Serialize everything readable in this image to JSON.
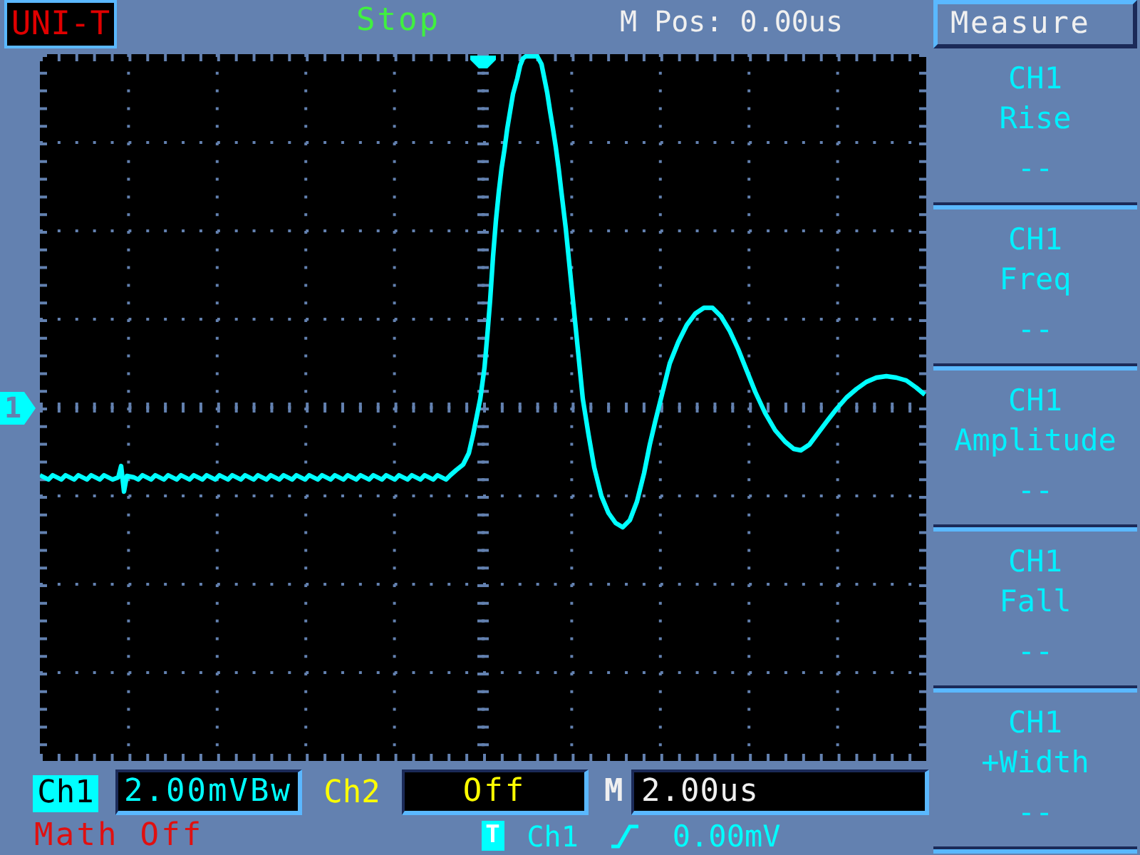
{
  "header": {
    "logo": "UNI-T",
    "run_status": "Stop",
    "position": "M Pos: 0.00us"
  },
  "display": {
    "channel_marker": "1"
  },
  "status": {
    "channels": [
      {
        "label": "Ch1",
        "scale": "2.00mVBw",
        "color": "#00ffff",
        "selected": true
      },
      {
        "label": "Ch2",
        "scale": "Off",
        "color": "#ffff00",
        "selected": false
      }
    ],
    "timebase": {
      "label": "M",
      "value": "2.00us"
    },
    "math": "Math Off",
    "trigger": {
      "badge": "T",
      "source": "Ch1",
      "rising": true,
      "level": "0.00mV"
    }
  },
  "menu": {
    "title": "Measure",
    "items": [
      {
        "channel": "CH1",
        "measure": "Rise",
        "value": "--"
      },
      {
        "channel": "CH1",
        "measure": "Freq",
        "value": "--"
      },
      {
        "channel": "CH1",
        "measure": "Amplitude",
        "value": "--"
      },
      {
        "channel": "CH1",
        "measure": "Fall",
        "value": "--"
      },
      {
        "channel": "CH1",
        "measure": "+Width",
        "value": "--"
      }
    ]
  }
}
